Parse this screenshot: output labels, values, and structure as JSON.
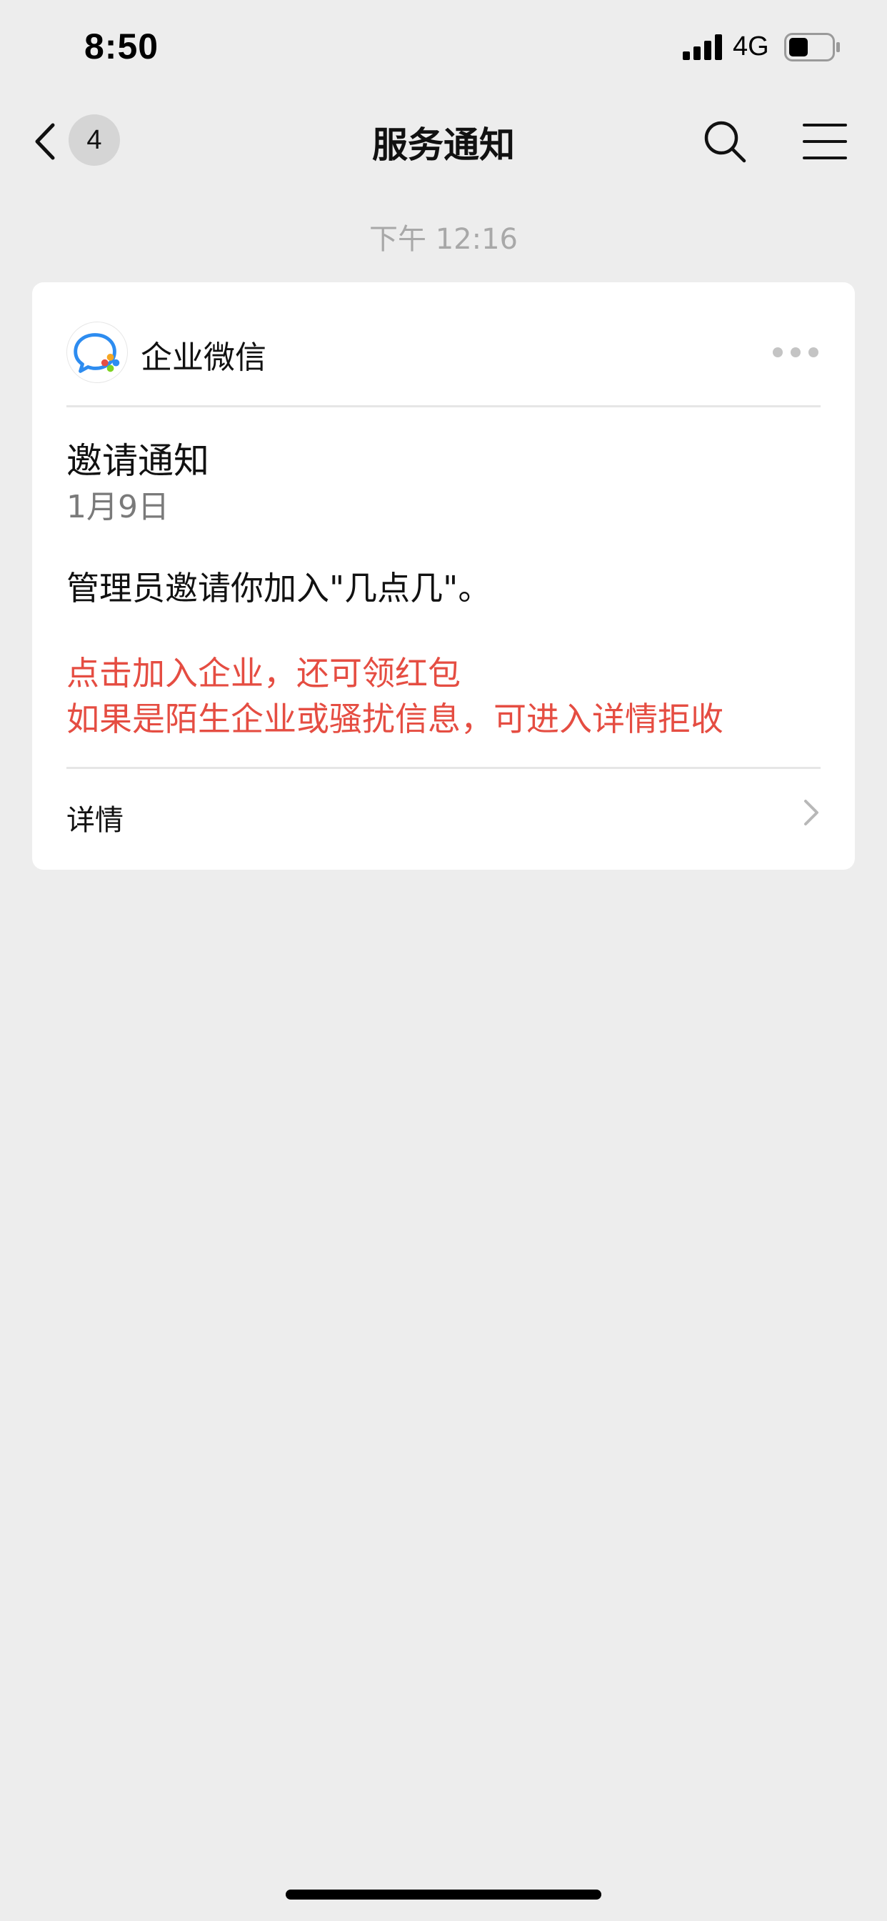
{
  "status_bar": {
    "time": "8:50",
    "network": "4G",
    "icons": [
      "signal-bars-icon",
      "battery-icon"
    ]
  },
  "nav": {
    "back_icon": "chevron-left-icon",
    "unread_count": "4",
    "title": "服务通知",
    "search_icon": "search-icon",
    "menu_icon": "hamburger-menu-icon"
  },
  "timestamp": "下午 12:16",
  "card": {
    "app_logo_icon": "wecom-logo-icon",
    "app_name": "企业微信",
    "more_icon": "more-dots-icon",
    "title": "邀请通知",
    "date": "1月9日",
    "body": "管理员邀请你加入\"几点几\"。",
    "highlight_line1": "点击加入企业，还可领红包",
    "highlight_line2": "如果是陌生企业或骚扰信息，可进入详情拒收",
    "details_label": "详情",
    "details_icon": "chevron-right-icon"
  },
  "colors": {
    "background": "#ededed",
    "card": "#ffffff",
    "highlight_text": "#e54d42",
    "timestamp_text": "#a8a8a8",
    "badge": "#d5d5d5"
  }
}
